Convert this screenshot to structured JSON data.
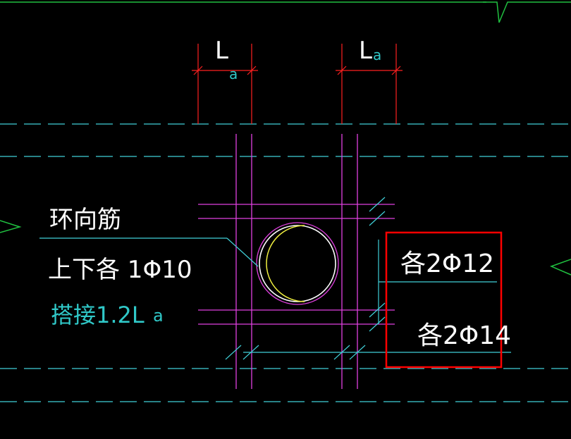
{
  "drawing": {
    "labels": {
      "la_left_main": "L",
      "la_left_sub": "a",
      "la_right_main": "L",
      "la_right_sub": "a",
      "ring_rebar": "环向筋",
      "top_bottom_each": "上下各 1Φ10",
      "lap_main": "搭接1.2L",
      "lap_sub": "a",
      "each_2phi12": "各2Φ12",
      "each_2phi14": "各2Φ14"
    },
    "colors": {
      "background": "#000000",
      "dim_red": "#ff2020",
      "rebar_magenta": "#e040e0",
      "axis_cyan": "#40d0d8",
      "text_white": "#ffffff",
      "text_cyan": "#30c8c8",
      "arc_yellow": "#f0f040",
      "highlight_red": "#ff0000",
      "edge_green": "#20c040"
    }
  }
}
